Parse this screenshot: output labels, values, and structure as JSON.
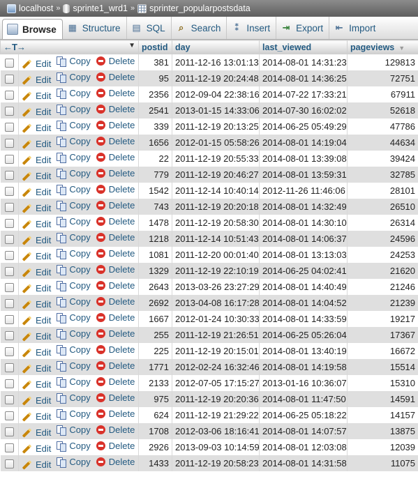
{
  "breadcrumb": {
    "server": "localhost",
    "database": "sprinte1_wrd1",
    "table": "sprinter_popularpostsdata",
    "separator": "»"
  },
  "tabs": [
    {
      "label": "Browse",
      "icon": "browse-icon",
      "active": true
    },
    {
      "label": "Structure",
      "icon": "structure-icon",
      "active": false
    },
    {
      "label": "SQL",
      "icon": "sql-icon",
      "active": false
    },
    {
      "label": "Search",
      "icon": "search-icon",
      "active": false
    },
    {
      "label": "Insert",
      "icon": "insert-icon",
      "active": false
    },
    {
      "label": "Export",
      "icon": "export-icon",
      "active": false
    },
    {
      "label": "Import",
      "icon": "import-icon",
      "active": false
    }
  ],
  "columns": {
    "postid": "postid",
    "day": "day",
    "last_viewed": "last_viewed",
    "pageviews": "pageviews"
  },
  "actions": {
    "edit": "Edit",
    "copy": "Copy",
    "delete": "Delete"
  },
  "rows": [
    [
      "381",
      "2011-12-16 13:01:13",
      "2014-08-01 14:31:23",
      "129813"
    ],
    [
      "95",
      "2011-12-19 20:24:48",
      "2014-08-01 14:36:25",
      "72751"
    ],
    [
      "2356",
      "2012-09-04 22:38:16",
      "2014-07-22 17:33:21",
      "67911"
    ],
    [
      "2541",
      "2013-01-15 14:33:06",
      "2014-07-30 16:02:02",
      "52618"
    ],
    [
      "339",
      "2011-12-19 20:13:25",
      "2014-06-25 05:49:29",
      "47786"
    ],
    [
      "1656",
      "2012-01-15 05:58:26",
      "2014-08-01 14:19:04",
      "44634"
    ],
    [
      "22",
      "2011-12-19 20:55:33",
      "2014-08-01 13:39:08",
      "39424"
    ],
    [
      "779",
      "2011-12-19 20:46:27",
      "2014-08-01 13:59:31",
      "32785"
    ],
    [
      "1542",
      "2011-12-14 10:40:14",
      "2012-11-26 11:46:06",
      "28101"
    ],
    [
      "743",
      "2011-12-19 20:20:18",
      "2014-08-01 14:32:49",
      "26510"
    ],
    [
      "1478",
      "2011-12-19 20:58:30",
      "2014-08-01 14:30:10",
      "26314"
    ],
    [
      "1218",
      "2011-12-14 10:51:43",
      "2014-08-01 14:06:37",
      "24596"
    ],
    [
      "1081",
      "2011-12-20 00:01:40",
      "2014-08-01 13:13:03",
      "24253"
    ],
    [
      "1329",
      "2011-12-19 22:10:19",
      "2014-06-25 04:02:41",
      "21620"
    ],
    [
      "2643",
      "2013-03-26 23:27:29",
      "2014-08-01 14:40:49",
      "21246"
    ],
    [
      "2692",
      "2013-04-08 16:17:28",
      "2014-08-01 14:04:52",
      "21239"
    ],
    [
      "1667",
      "2012-01-24 10:30:33",
      "2014-08-01 14:33:59",
      "19217"
    ],
    [
      "255",
      "2011-12-19 21:26:51",
      "2014-06-25 05:26:04",
      "17367"
    ],
    [
      "225",
      "2011-12-19 20:15:01",
      "2014-08-01 13:40:19",
      "16672"
    ],
    [
      "1771",
      "2012-02-24 16:32:46",
      "2014-08-01 14:19:58",
      "15514"
    ],
    [
      "2133",
      "2012-07-05 17:15:27",
      "2013-01-16 10:36:07",
      "15310"
    ],
    [
      "975",
      "2011-12-19 20:20:36",
      "2014-08-01 11:47:50",
      "14591"
    ],
    [
      "624",
      "2011-12-19 21:29:22",
      "2014-06-25 05:18:22",
      "14157"
    ],
    [
      "1708",
      "2012-03-06 18:16:41",
      "2014-08-01 14:07:57",
      "13875"
    ],
    [
      "2926",
      "2013-09-03 10:14:59",
      "2014-08-01 12:03:08",
      "12039"
    ],
    [
      "1433",
      "2011-12-19 20:58:23",
      "2014-08-01 14:31:58",
      "11075"
    ]
  ]
}
